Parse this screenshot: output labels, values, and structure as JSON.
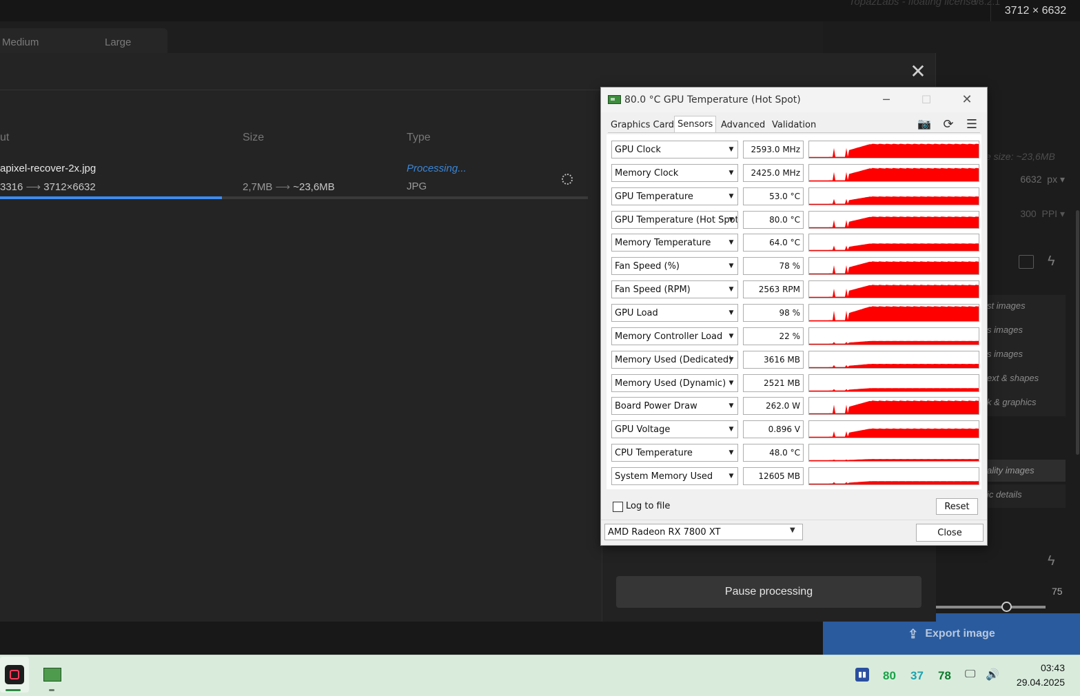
{
  "background_app": {
    "license_text": "TopazLabs - floating license",
    "version": "v8.2.1",
    "output_dims": "3712 × 6632",
    "size_options": [
      "Medium",
      "Large"
    ],
    "side_panel": {
      "file_size_text": "e size: ~23,6MB",
      "width_value": "6632",
      "width_unit": "px",
      "ppi_value": "300",
      "ppi_unit": "PPI",
      "model_items": [
        "st images",
        "s images",
        "s images",
        "ext & shapes",
        "k & graphics"
      ],
      "quality_items": [
        "ality images",
        "ic details"
      ],
      "slider_value": "75",
      "slider_level_percent": 62
    },
    "export_label": "Export image"
  },
  "modal": {
    "columns": {
      "output": "ut",
      "size": "Size",
      "type": "Type"
    },
    "file": {
      "name": "apixel-recover-2x.jpg",
      "resolution_from": "3316",
      "resolution_to": "3712×6632",
      "size_from": "2,7MB",
      "size_to": "~23,6MB",
      "status": "Processing...",
      "type": "JPG",
      "progress_percent": 37.8
    },
    "pause_label": "Pause processing"
  },
  "gpuz": {
    "title": "80.0 °C GPU Temperature (Hot Spot)",
    "tabs": [
      "Graphics Card",
      "Sensors",
      "Advanced",
      "Validation"
    ],
    "active_tab": "Sensors",
    "sensors": [
      {
        "name": "GPU Clock",
        "value": "2593.0 MHz",
        "level": 0.85
      },
      {
        "name": "Memory Clock",
        "value": "2425.0 MHz",
        "level": 0.8
      },
      {
        "name": "GPU Temperature",
        "value": "53.0 °C",
        "level": 0.5
      },
      {
        "name": "GPU Temperature (Hot Spot)",
        "value": "80.0 °C",
        "level": 0.7
      },
      {
        "name": "Memory Temperature",
        "value": "64.0 °C",
        "level": 0.45
      },
      {
        "name": "Fan Speed (%)",
        "value": "78 %",
        "level": 0.78
      },
      {
        "name": "Fan Speed (RPM)",
        "value": "2563 RPM",
        "level": 0.78
      },
      {
        "name": "GPU Load",
        "value": "98 %",
        "level": 0.9
      },
      {
        "name": "Memory Controller Load",
        "value": "22 %",
        "level": 0.22
      },
      {
        "name": "Memory Used (Dedicated)",
        "value": "3616 MB",
        "level": 0.25
      },
      {
        "name": "Memory Used (Dynamic)",
        "value": "2521 MB",
        "level": 0.2
      },
      {
        "name": "Board Power Draw",
        "value": "262.0 W",
        "level": 0.82
      },
      {
        "name": "GPU Voltage",
        "value": "0.896 V",
        "level": 0.55
      },
      {
        "name": "CPU Temperature",
        "value": "48.0 °C",
        "level": 0.12
      },
      {
        "name": "System Memory Used",
        "value": "12605 MB",
        "level": 0.2
      }
    ],
    "log_label": "Log to file",
    "reset_label": "Reset",
    "gpu_select": "AMD Radeon RX 7800 XT",
    "close_label": "Close",
    "graph_color": "#ff0000"
  },
  "taskbar": {
    "tray_values": [
      {
        "value": "80",
        "color": "#19a346"
      },
      {
        "value": "37",
        "color": "#1aa3b0"
      },
      {
        "value": "78",
        "color": "#0d7a2c"
      }
    ],
    "time": "03:43",
    "date": "29.04.2025"
  }
}
